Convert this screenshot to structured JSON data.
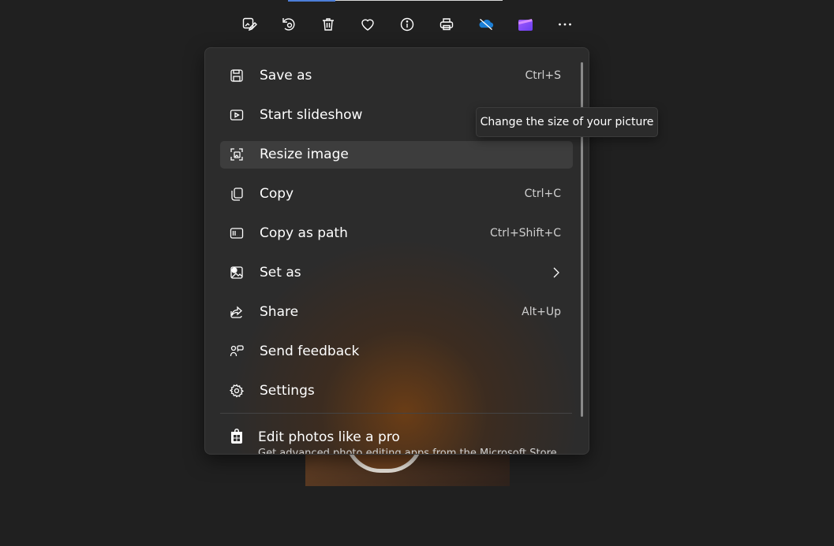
{
  "toolbar": {
    "buttons": [
      {
        "icon": "edit-image-icon"
      },
      {
        "icon": "rotate-icon"
      },
      {
        "icon": "delete-icon"
      },
      {
        "icon": "favorite-heart-icon"
      },
      {
        "icon": "info-icon"
      },
      {
        "icon": "print-icon"
      },
      {
        "icon": "onedrive-off-icon"
      },
      {
        "icon": "clipchamp-icon"
      },
      {
        "icon": "more-options-icon"
      }
    ]
  },
  "menu": {
    "items": [
      {
        "label": "Save as",
        "shortcut": "Ctrl+S",
        "icon": "save-icon"
      },
      {
        "label": "Start slideshow",
        "shortcut": "",
        "icon": "slideshow-icon"
      },
      {
        "label": "Resize image",
        "shortcut": "",
        "icon": "resize-icon",
        "hovered": true
      },
      {
        "label": "Copy",
        "shortcut": "Ctrl+C",
        "icon": "copy-icon"
      },
      {
        "label": "Copy as path",
        "shortcut": "Ctrl+Shift+C",
        "icon": "copy-path-icon"
      },
      {
        "label": "Set as",
        "shortcut": "",
        "icon": "set-as-icon",
        "submenu": true
      },
      {
        "label": "Share",
        "shortcut": "Alt+Up",
        "icon": "share-icon"
      },
      {
        "label": "Send feedback",
        "shortcut": "",
        "icon": "feedback-icon"
      },
      {
        "label": "Settings",
        "shortcut": "",
        "icon": "settings-icon"
      }
    ],
    "promo": {
      "title": "Edit photos like a pro",
      "subtitle": "Get advanced photo editing apps from the Microsoft Store",
      "icon": "store-icon"
    }
  },
  "tooltip": {
    "text": "Change the size of your picture"
  },
  "colors": {
    "background": "#202020",
    "menu": "#2c2c2c",
    "hover": "#3d3d3d",
    "accent": "#4c7ed8"
  }
}
